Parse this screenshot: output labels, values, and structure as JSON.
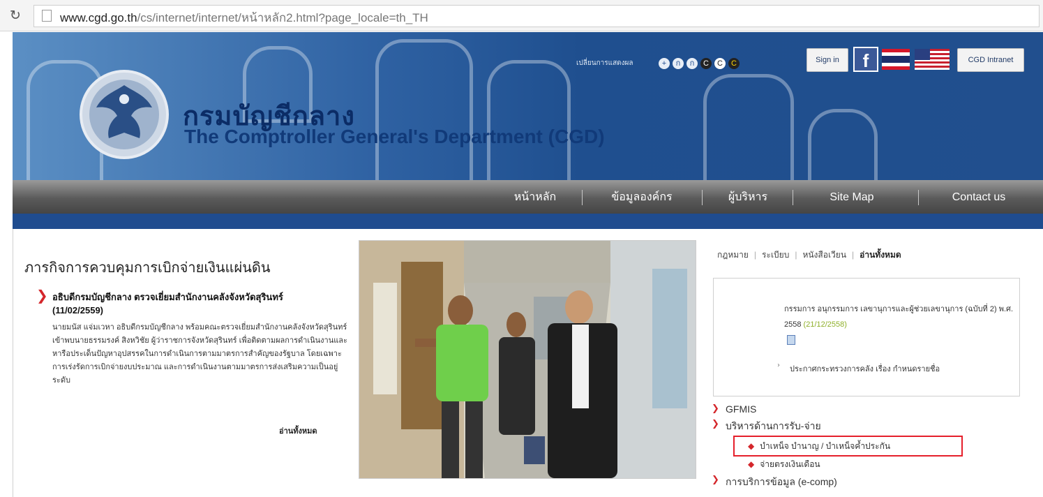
{
  "browser": {
    "url_domain": "www.cgd.go.th",
    "url_path": "/cs/internet/internet/หน้าหลัก2.html?page_locale=th_TH"
  },
  "header": {
    "site_title_th": "กรมบัญชีกลาง",
    "site_title_en": "The Comptroller General's Department (CGD)",
    "font_size_label": "เปลี่ยนการแสดงผล",
    "font_buttons": [
      "+",
      "ก",
      "ก",
      "C",
      "C",
      "C"
    ],
    "sign_in": "Sign in",
    "facebook": "f",
    "intranet": "CGD Intranet",
    "colors": {
      "banner": "#2f62a3",
      "nav": "#5a5a5a",
      "strip": "#1f4c8f"
    }
  },
  "nav": {
    "items": [
      "หน้าหลัก",
      "ข้อมูลองค์กร",
      "ผู้บริหาร",
      "Site Map",
      "Contact us"
    ]
  },
  "news": {
    "heading": "ภารกิจการควบคุมการเบิกจ่ายเงินแผ่นดิน",
    "title": "อธิบดีกรมบัญชีกลาง ตรวจเยี่ยมสำนักงานคลังจังหวัดสุรินทร์ (11/02/2559)",
    "body": "นายมนัส แจ่มเวหา อธิบดีกรมบัญชีกลาง พร้อมคณะตรวจเยี่ยมสำนักงานคลังจังหวัดสุรินทร์ เข้าพบนายธรรมรงค์ สิงหวิชัย ผู้ว่าราชการจังหวัดสุรินทร์ เพื่อติดตามผลการดำเนินงานและหารือประเด็นปัญหาอุปสรรคในการดำเนินการตามมาตรการสำคัญของรัฐบาล โดยเฉพาะการเร่งรัดการเบิกจ่ายงบประมาณ และการดำเนินงานตามมาตรการส่งเสริมความเป็นอยู่ระดับ",
    "read_all": "อ่านทั้งหมด"
  },
  "docs": {
    "tabs": [
      "กฎหมาย",
      "ระเบียบ",
      "หนังสือเวียน",
      "อ่านทั้งหมด"
    ],
    "item1_text": "กรรมการ อนุกรรมการ เลขานุการและผู้ช่วยเลขานุการ (ฉบับที่ 2) พ.ศ. 2558",
    "item1_date": "(21/12/2558)",
    "item2_text": "ประกาศกระทรวงการคลัง เรื่อง กำหนดรายชื่อ"
  },
  "menu": {
    "gfmis": "GFMIS",
    "payment": "บริหารด้านการรับ-จ่าย",
    "pension": "บำเหน็จ บำนาญ / บำเหน็จค้ำประกัน",
    "salary": "จ่ายตรงเงินเดือน",
    "ecomp": "การบริการข้อมูล (e-comp)"
  }
}
